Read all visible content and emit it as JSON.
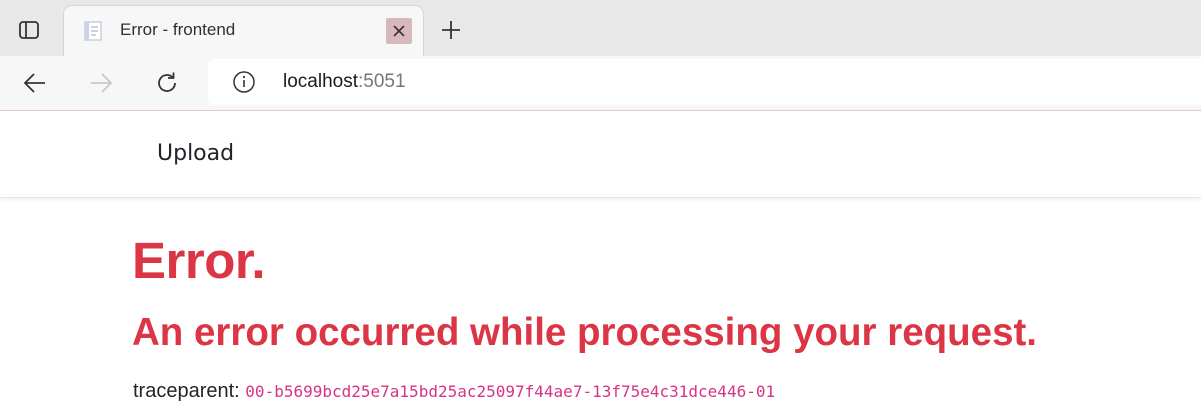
{
  "browser": {
    "tab": {
      "title": "Error - frontend"
    },
    "new_tab_symbol": "+",
    "address": {
      "host": "localhost",
      "port": ":5051"
    },
    "icons": {
      "tab_actions": "tab-actions-icon",
      "favicon": "page-favicon-icon",
      "close": "close-icon",
      "new_tab": "plus-icon",
      "back": "back-arrow-icon",
      "forward": "forward-arrow-icon",
      "refresh": "refresh-icon",
      "site_info": "info-icon"
    }
  },
  "page": {
    "nav": {
      "upload_label": "Upload"
    },
    "error": {
      "title": "Error.",
      "subtitle": "An error occurred while processing your request.",
      "trace_label": "traceparent: ",
      "trace_value": "00-b5699bcd25e7a15bd25ac25097f44ae7-13f75e4c31dce446-01"
    }
  },
  "colors": {
    "error_red": "#dc3545",
    "code_pink": "#d63384",
    "tabstrip_bg": "#e8e8e8",
    "toolbar_bg": "#f7f7f7",
    "tab_close_bg": "#d9b8bd"
  }
}
